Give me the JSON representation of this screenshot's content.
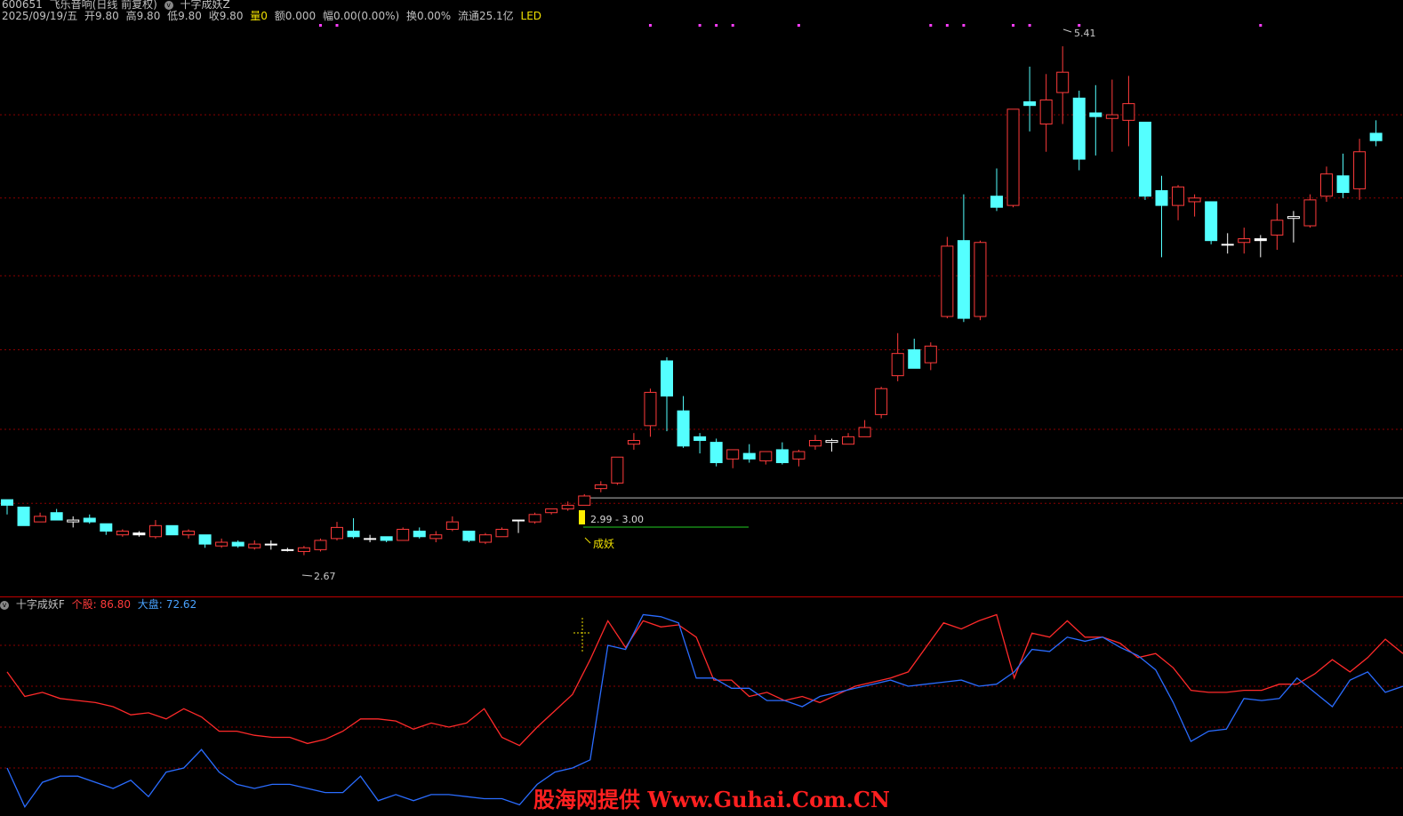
{
  "header": {
    "code": "600651",
    "name": "飞乐音响(日线 前复权)",
    "indicator": "十字成妖Z",
    "date": "2025/09/19/五",
    "open": "开9.80",
    "high": "高9.80",
    "low": "低9.80",
    "close": "收9.80",
    "vol": "量0",
    "amount": "额0.000",
    "change": "幅0.00(0.00%)",
    "turnover": "换0.00%",
    "float": "流通25.1亿",
    "led": "LED"
  },
  "sub": {
    "name": "十字成妖F",
    "stock_label": "个股:",
    "stock_val": "86.80",
    "market_label": "大盘:",
    "market_val": "72.62"
  },
  "annotations": {
    "high_label": "5.41",
    "low_label": "2.67",
    "range_label": "2.99 - 3.00",
    "signal_label": "成妖"
  },
  "watermark": "股海网提供 Www.Guhai.Com.CN",
  "colors": {
    "up": "#ff3b3b",
    "down": "#54ffff",
    "grid": "#8b0000",
    "stock_line": "#ff2a2a",
    "market_line": "#2a6cff",
    "dots": "#ff3cff"
  },
  "chart_data": [
    {
      "type": "candlestick",
      "ylim": [
        2.5,
        5.55
      ],
      "grid_values": [
        2.95,
        3.35,
        3.78,
        4.18,
        4.6,
        5.05
      ],
      "candles": [
        [
          2.97,
          2.94,
          2.95,
          2.89
        ],
        [
          2.93,
          2.83,
          2.93,
          2.83
        ],
        [
          2.85,
          2.88,
          2.9,
          2.85
        ],
        [
          2.9,
          2.86,
          2.92,
          2.86
        ],
        [
          2.85,
          2.86,
          2.88,
          2.82
        ],
        [
          2.87,
          2.85,
          2.89,
          2.84
        ],
        [
          2.84,
          2.8,
          2.84,
          2.78
        ],
        [
          2.78,
          2.8,
          2.81,
          2.77
        ],
        [
          2.79,
          2.78,
          2.8,
          2.77
        ],
        [
          2.77,
          2.83,
          2.86,
          2.76
        ],
        [
          2.83,
          2.78,
          2.83,
          2.78
        ],
        [
          2.78,
          2.8,
          2.81,
          2.76
        ],
        [
          2.78,
          2.73,
          2.78,
          2.71
        ],
        [
          2.72,
          2.74,
          2.76,
          2.71
        ],
        [
          2.74,
          2.72,
          2.75,
          2.71
        ],
        [
          2.71,
          2.73,
          2.75,
          2.7
        ],
        [
          2.73,
          2.73,
          2.75,
          2.7
        ],
        [
          2.7,
          2.7,
          2.71,
          2.69
        ],
        [
          2.69,
          2.71,
          2.72,
          2.67
        ],
        [
          2.7,
          2.75,
          2.76,
          2.69
        ],
        [
          2.76,
          2.82,
          2.85,
          2.75
        ],
        [
          2.8,
          2.77,
          2.87,
          2.76
        ],
        [
          2.76,
          2.76,
          2.78,
          2.74
        ],
        [
          2.77,
          2.75,
          2.77,
          2.74
        ],
        [
          2.75,
          2.81,
          2.82,
          2.75
        ],
        [
          2.8,
          2.77,
          2.82,
          2.76
        ],
        [
          2.76,
          2.78,
          2.8,
          2.74
        ],
        [
          2.81,
          2.85,
          2.88,
          2.8
        ],
        [
          2.8,
          2.75,
          2.8,
          2.74
        ],
        [
          2.74,
          2.78,
          2.79,
          2.73
        ],
        [
          2.77,
          2.81,
          2.82,
          2.77
        ],
        [
          2.86,
          2.86,
          2.86,
          2.79
        ],
        [
          2.85,
          2.89,
          2.9,
          2.84
        ],
        [
          2.9,
          2.92,
          2.92,
          2.89
        ],
        [
          2.92,
          2.94,
          2.96,
          2.91
        ],
        [
          2.94,
          2.99,
          3.0,
          2.94
        ],
        [
          3.03,
          3.05,
          3.07,
          3.01
        ],
        [
          3.06,
          3.2,
          3.2,
          3.05
        ],
        [
          3.27,
          3.29,
          3.33,
          3.24
        ],
        [
          3.37,
          3.55,
          3.57,
          3.31
        ],
        [
          3.72,
          3.53,
          3.74,
          3.34
        ],
        [
          3.45,
          3.26,
          3.53,
          3.25
        ],
        [
          3.31,
          3.29,
          3.33,
          3.22
        ],
        [
          3.28,
          3.17,
          3.3,
          3.15
        ],
        [
          3.19,
          3.24,
          3.24,
          3.14
        ],
        [
          3.22,
          3.19,
          3.27,
          3.17
        ],
        [
          3.18,
          3.23,
          3.23,
          3.16
        ],
        [
          3.24,
          3.17,
          3.28,
          3.16
        ],
        [
          3.19,
          3.23,
          3.24,
          3.15
        ],
        [
          3.26,
          3.29,
          3.32,
          3.24
        ],
        [
          3.28,
          3.29,
          3.3,
          3.23
        ],
        [
          3.27,
          3.31,
          3.33,
          3.27
        ],
        [
          3.31,
          3.36,
          3.4,
          3.31
        ],
        [
          3.43,
          3.57,
          3.58,
          3.41
        ],
        [
          3.64,
          3.76,
          3.87,
          3.61
        ],
        [
          3.78,
          3.68,
          3.84,
          3.68
        ],
        [
          3.71,
          3.8,
          3.82,
          3.67
        ],
        [
          3.96,
          4.34,
          4.39,
          3.95
        ],
        [
          4.37,
          3.95,
          4.62,
          3.93
        ],
        [
          3.96,
          4.36,
          4.37,
          3.94
        ],
        [
          4.61,
          4.55,
          4.76,
          4.53
        ],
        [
          4.56,
          5.08,
          5.08,
          4.55
        ],
        [
          5.12,
          5.1,
          5.31,
          4.96
        ],
        [
          5.0,
          5.13,
          5.27,
          4.85
        ],
        [
          5.17,
          5.28,
          5.42,
          5.0
        ],
        [
          5.14,
          4.81,
          5.18,
          4.75
        ],
        [
          5.06,
          5.04,
          5.21,
          4.83
        ],
        [
          5.03,
          5.05,
          5.24,
          4.85
        ],
        [
          5.02,
          5.11,
          5.26,
          4.88
        ],
        [
          5.01,
          4.61,
          5.01,
          4.59
        ],
        [
          4.64,
          4.56,
          4.72,
          4.28
        ],
        [
          4.56,
          4.66,
          4.67,
          4.48
        ],
        [
          4.58,
          4.6,
          4.62,
          4.5
        ],
        [
          4.58,
          4.37,
          4.58,
          4.35
        ],
        [
          4.35,
          4.35,
          4.41,
          4.3
        ],
        [
          4.36,
          4.38,
          4.44,
          4.3
        ],
        [
          4.38,
          4.37,
          4.4,
          4.28
        ],
        [
          4.4,
          4.48,
          4.57,
          4.32
        ],
        [
          4.49,
          4.5,
          4.53,
          4.36
        ],
        [
          4.45,
          4.59,
          4.62,
          4.44
        ],
        [
          4.61,
          4.73,
          4.77,
          4.58
        ],
        [
          4.72,
          4.63,
          4.84,
          4.6
        ],
        [
          4.65,
          4.85,
          4.92,
          4.59
        ],
        [
          4.95,
          4.91,
          5.02,
          4.88
        ]
      ],
      "last_close_line": 2.98,
      "signal_dots_at_index": [
        19,
        20,
        39,
        42,
        43,
        44,
        48,
        56,
        57,
        58,
        61,
        62,
        65,
        76
      ]
    },
    {
      "type": "line",
      "ylim": [
        0,
        100
      ],
      "grid_values": [
        80,
        60,
        40,
        20
      ],
      "series": [
        {
          "name": "个股",
          "values": [
            67,
            55,
            57,
            54,
            53,
            52,
            50,
            46,
            47,
            44,
            49,
            45,
            38,
            38,
            36,
            35,
            35,
            32,
            34,
            38,
            44,
            44,
            43,
            39,
            42,
            40,
            42,
            49,
            35,
            31,
            40,
            48,
            56,
            73,
            92,
            79,
            92,
            89,
            90,
            84,
            63,
            63,
            55,
            57,
            53,
            55,
            52,
            56,
            60,
            62,
            64,
            67,
            79,
            91,
            88,
            92,
            95,
            64,
            86,
            84,
            92,
            84,
            84,
            81,
            74,
            76,
            69,
            58,
            57,
            57,
            58,
            58,
            61,
            61,
            66,
            73,
            67,
            74,
            83,
            76
          ]
        },
        {
          "name": "大盘",
          "values": [
            20,
            1,
            13,
            16,
            16,
            13,
            10,
            14,
            6,
            18,
            20,
            29,
            18,
            12,
            10,
            12,
            12,
            10,
            8,
            8,
            16,
            4,
            7,
            4,
            7,
            7,
            6,
            5,
            5,
            2,
            12,
            18,
            20,
            24,
            80,
            78,
            95,
            94,
            91,
            64,
            64,
            59,
            59,
            53,
            53,
            50,
            55,
            57,
            59,
            61,
            63,
            60,
            61,
            62,
            63,
            60,
            61,
            67,
            78,
            77,
            84,
            82,
            84,
            79,
            75,
            68,
            52,
            33,
            38,
            39,
            54,
            53,
            54,
            64,
            57,
            50,
            63,
            67,
            57,
            60
          ]
        }
      ]
    }
  ]
}
